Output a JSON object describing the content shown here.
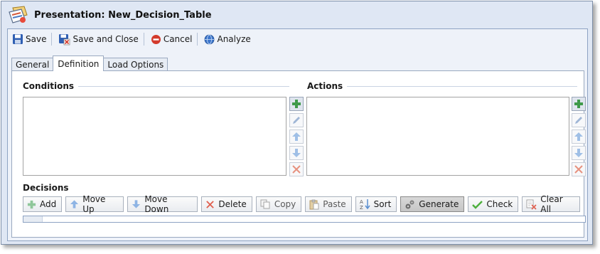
{
  "window": {
    "title": "Presentation: New_Decision_Table"
  },
  "toolbar": {
    "save": "Save",
    "save_and_close": "Save and Close",
    "cancel": "Cancel",
    "analyze": "Analyze"
  },
  "tabs": [
    {
      "label": "General"
    },
    {
      "label": "Definition",
      "active": true
    },
    {
      "label": "Load Options"
    }
  ],
  "conditions": {
    "title": "Conditions",
    "items": []
  },
  "actions": {
    "title": "Actions",
    "items": []
  },
  "decisions": {
    "title": "Decisions",
    "buttons": {
      "add": "Add",
      "move_up": "Move Up",
      "move_down": "Move Down",
      "delete": "Delete",
      "copy": "Copy",
      "paste": "Paste",
      "sort": "Sort",
      "generate": "Generate",
      "check": "Check",
      "clear_all": "Clear All"
    }
  },
  "colors": {
    "add_green": "#3f9a4a",
    "cancel_red": "#d33a2c",
    "delete_red": "#e0604f",
    "arrow_blue": "#5b8fd0",
    "check_green": "#4caf3c"
  }
}
